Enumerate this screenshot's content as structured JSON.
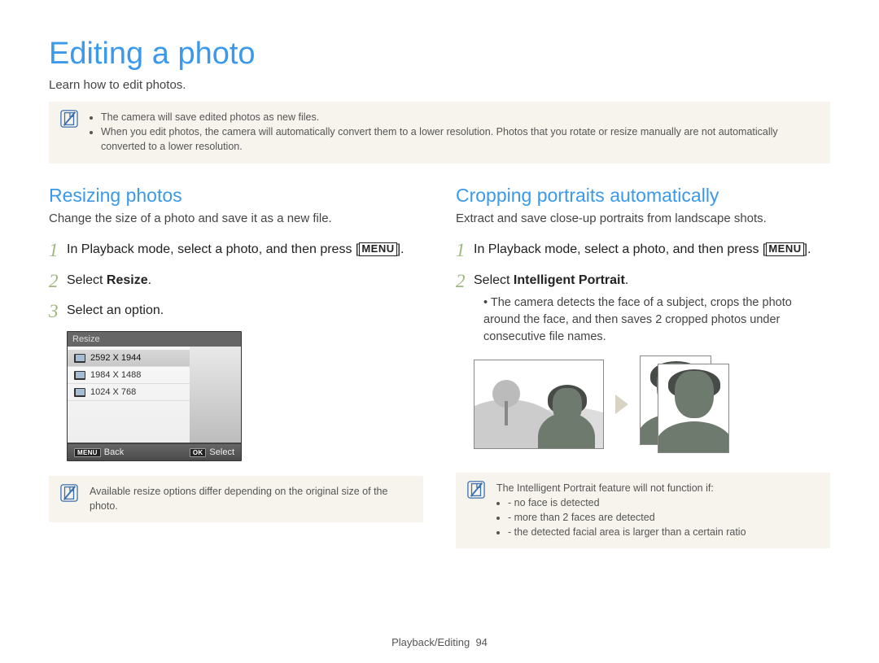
{
  "title": "Editing a photo",
  "intro": "Learn how to edit photos.",
  "top_notes": [
    "The camera will save edited photos as new files.",
    "When you edit photos, the camera will automatically convert them to a lower resolution. Photos that you rotate or resize manually are not automatically converted to a lower resolution."
  ],
  "left": {
    "title": "Resizing photos",
    "sub": "Change the size of a photo and save it as a new file.",
    "step1_a": "In Playback mode, select a photo, and then press [",
    "step1_b": "].",
    "step2_a": "Select ",
    "step2_b": "Resize",
    "step2_c": ".",
    "step3": "Select an option.",
    "lcd": {
      "title": "Resize",
      "items": [
        {
          "res": "2592 X 1944",
          "selected": true
        },
        {
          "res": "1984 X 1488",
          "selected": false
        },
        {
          "res": "1024 X 768",
          "selected": false
        }
      ],
      "back_key": "MENU",
      "back_label": "Back",
      "ok_key": "OK",
      "select_label": "Select"
    },
    "footnote": "Available resize options differ depending on the original size of the photo."
  },
  "right": {
    "title": "Cropping portraits automatically",
    "sub": "Extract and save close-up portraits from landscape shots.",
    "step1_a": "In Playback mode, select a photo, and then press [",
    "step1_b": "].",
    "step2_a": "Select ",
    "step2_b": "Intelligent Portrait",
    "step2_c": ".",
    "step2_sub": "The camera detects the face of a subject, crops the photo around the face, and then saves 2 cropped photos under consecutive file names.",
    "footnote_lead": "The Intelligent Portrait feature will not function if:",
    "footnote_items": [
      "no face is detected",
      "more than 2 faces are detected",
      "the detected facial area is larger than a certain ratio"
    ]
  },
  "menu_glyph": "MENU",
  "footer_section": "Playback/Editing",
  "footer_page": "94"
}
